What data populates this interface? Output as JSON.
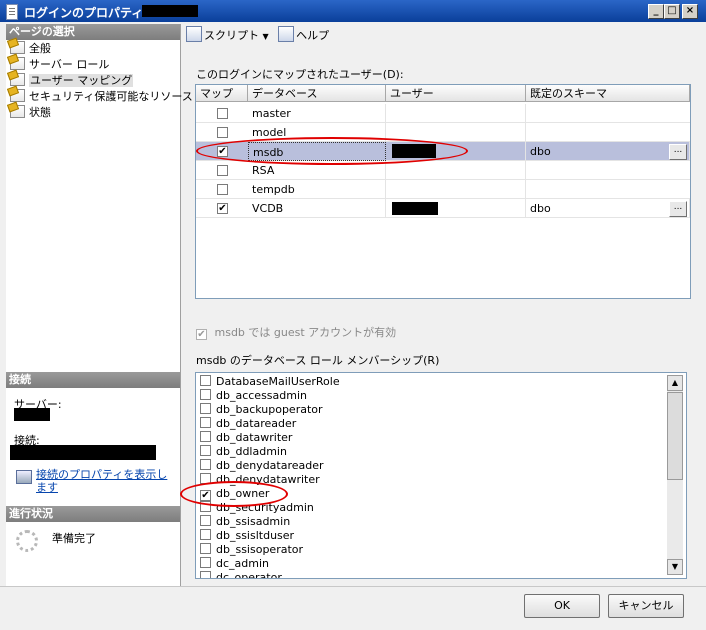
{
  "window": {
    "title": "ログインのプロパティ -"
  },
  "left": {
    "page_select_header": "ページの選択",
    "nav_items": [
      {
        "label": "全般"
      },
      {
        "label": "サーバー ロール"
      },
      {
        "label": "ユーザー マッピング"
      },
      {
        "label": "セキュリティ保護可能なリソース"
      },
      {
        "label": "状態"
      }
    ],
    "connection_header": "接続",
    "server_label": "サーバー:",
    "connection_label": "接続:",
    "view_connection_props": "接続のプロパティを表示します",
    "progress_header": "進行状況",
    "status": "準備完了"
  },
  "toolbar": {
    "script_label": "スクリプト",
    "help_label": "ヘルプ"
  },
  "mapping": {
    "section_label": "このログインにマップされたユーザー(D):",
    "columns": [
      "マップ",
      "データベース",
      "ユーザー",
      "既定のスキーマ"
    ],
    "rows": [
      {
        "database": "master",
        "checked": false,
        "schema": ""
      },
      {
        "database": "model",
        "checked": false,
        "schema": ""
      },
      {
        "database": "msdb",
        "checked": true,
        "schema": "dbo"
      },
      {
        "database": "RSA",
        "checked": false,
        "schema": ""
      },
      {
        "database": "tempdb",
        "checked": false,
        "schema": ""
      },
      {
        "database": "VCDB",
        "checked": true,
        "schema": "dbo"
      }
    ],
    "guest_label": "msdb では guest アカウントが有効",
    "ellipsis": "..."
  },
  "roles": {
    "section_label": "msdb のデータベース ロール メンバーシップ(R)",
    "items": [
      {
        "name": "DatabaseMailUserRole",
        "checked": false
      },
      {
        "name": "db_accessadmin",
        "checked": false
      },
      {
        "name": "db_backupoperator",
        "checked": false
      },
      {
        "name": "db_datareader",
        "checked": false
      },
      {
        "name": "db_datawriter",
        "checked": false
      },
      {
        "name": "db_ddladmin",
        "checked": false
      },
      {
        "name": "db_denydatareader",
        "checked": false
      },
      {
        "name": "db_denydatawriter",
        "checked": false
      },
      {
        "name": "db_owner",
        "checked": true
      },
      {
        "name": "db_securityadmin",
        "checked": false
      },
      {
        "name": "db_ssisadmin",
        "checked": false
      },
      {
        "name": "db_ssisltduser",
        "checked": false
      },
      {
        "name": "db_ssisoperator",
        "checked": false
      },
      {
        "name": "dc_admin",
        "checked": false
      },
      {
        "name": "dc_operator",
        "checked": false
      }
    ]
  },
  "buttons": {
    "ok": "OK",
    "cancel": "キャンセル"
  },
  "colors": {
    "titlebar": "#0a3f9a",
    "selected_row": "#b9bfdc",
    "highlight_ring": "#e00000"
  }
}
